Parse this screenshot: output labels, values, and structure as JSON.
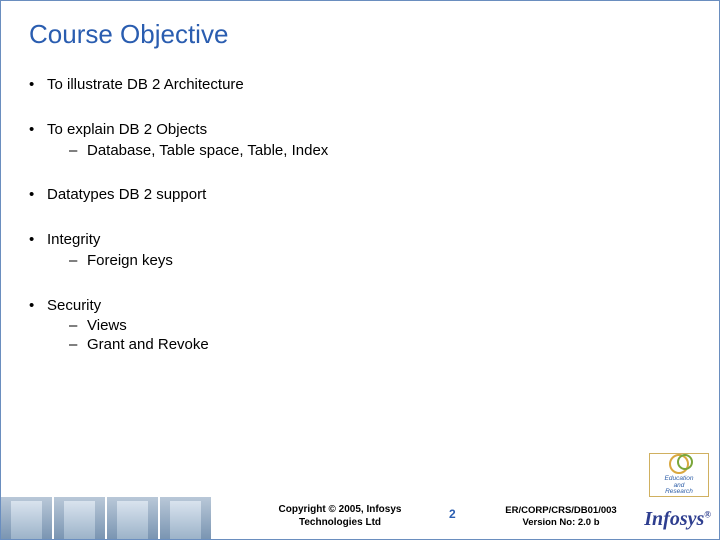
{
  "title": "Course Objective",
  "bullets": [
    {
      "text": "To illustrate DB 2 Architecture",
      "sub": []
    },
    {
      "text": "To explain DB 2 Objects",
      "sub": [
        "Database, Table space, Table, Index"
      ]
    },
    {
      "text": "Datatypes DB 2 support",
      "sub": []
    },
    {
      "text": "Integrity",
      "sub": [
        "Foreign keys"
      ]
    },
    {
      "text": "Security",
      "sub": [
        "Views",
        "Grant and Revoke"
      ]
    }
  ],
  "footer": {
    "copyright_line1": "Copyright © 2005, Infosys",
    "copyright_line2": "Technologies Ltd",
    "page_number": "2",
    "ref_line1": "ER/CORP/CRS/DB01/003",
    "ref_line2": "Version No: 2.0 b",
    "logo_text": "Infosys",
    "edu_line1": "Education",
    "edu_line2": "and",
    "edu_line3": "Research"
  }
}
